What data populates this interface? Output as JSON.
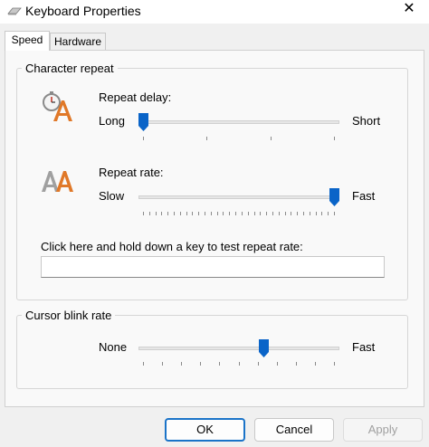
{
  "window": {
    "title": "Keyboard Properties",
    "close_glyph": "✕"
  },
  "tabs": [
    {
      "label": "Speed",
      "active": true
    },
    {
      "label": "Hardware",
      "active": false
    }
  ],
  "character_repeat": {
    "group_label": "Character repeat",
    "repeat_delay": {
      "label": "Repeat delay:",
      "min_label": "Long",
      "max_label": "Short",
      "value_fraction": 0.0,
      "tick_count": 4,
      "icon": "stopwatch-letter-icon"
    },
    "repeat_rate": {
      "label": "Repeat rate:",
      "min_label": "Slow",
      "max_label": "Fast",
      "value_fraction": 1.0,
      "tick_count": 32,
      "icon": "repeated-letter-icon"
    },
    "test_label": "Click here and hold down a key to test repeat rate:",
    "test_value": ""
  },
  "cursor_blink": {
    "group_label": "Cursor blink rate",
    "min_label": "None",
    "max_label": "Fast",
    "value_fraction": 0.63,
    "tick_count": 11
  },
  "buttons": {
    "ok": "OK",
    "cancel": "Cancel",
    "apply": "Apply"
  },
  "colors": {
    "accent": "#0a64c8",
    "icon_orange": "#e07828"
  }
}
